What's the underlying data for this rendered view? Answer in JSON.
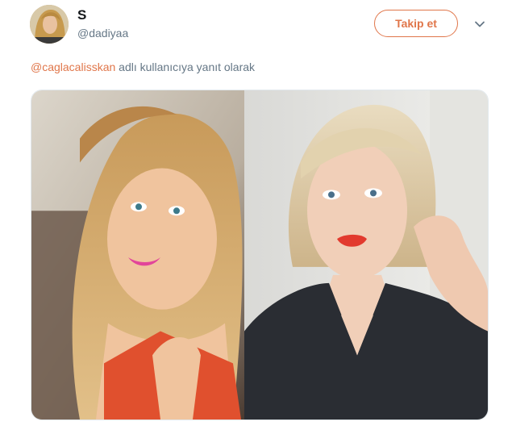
{
  "tweet": {
    "display_name": "S",
    "username": "@dadiyaa",
    "follow_label": "Takip et",
    "reply_mention": "@caglacalisskan",
    "reply_suffix": " adlı kullanıcıya yanıt olarak"
  },
  "icons": {
    "caret": "chevron-down-icon"
  },
  "colors": {
    "accent": "#e0764a",
    "secondary_text": "#657786",
    "primary_text": "#14171a"
  }
}
